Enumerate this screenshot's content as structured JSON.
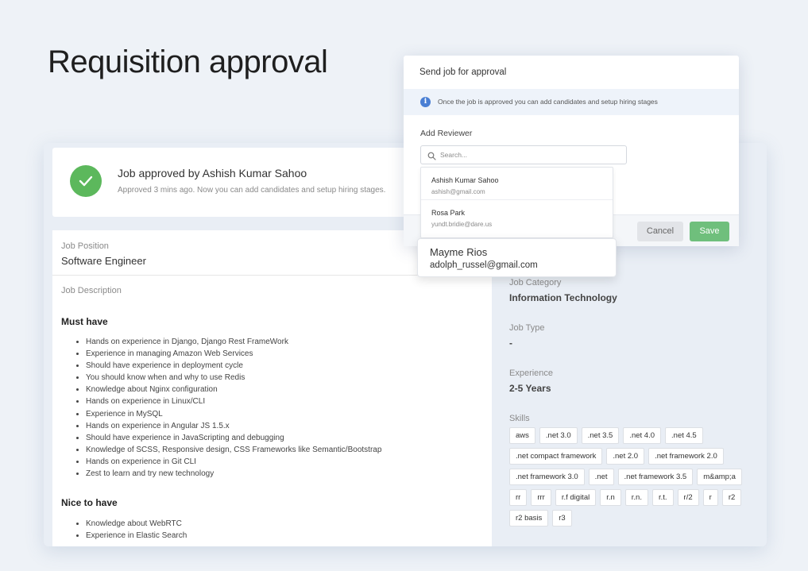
{
  "page": {
    "title": "Requisition approval"
  },
  "approval": {
    "title": "Job approved by Ashish Kumar Sahoo",
    "subtitle": "Approved 3 mins ago. Now you can add candidates and setup hiring stages."
  },
  "job": {
    "position_label": "Job Position",
    "position_value": "Software Engineer",
    "description_label": "Job Description",
    "must_have_heading": "Must have",
    "must_have": [
      "Hands on experience in Django, Django Rest FrameWork",
      "Experience in managing Amazon Web Services",
      "Should have experience in deployment cycle",
      "You should know when and why to use Redis",
      "Knowledge about Nginx configuration",
      "Hands on experience in Linux/CLI",
      "Experience in MySQL",
      "Hands on experience in Angular JS 1.5.x",
      "Should have experience in JavaScripting and debugging",
      "Knowledge of SCSS, Responsive design, CSS Frameworks like Semantic/Bootstrap",
      "Hands on experience in Git CLI",
      "Zest to learn and try new technology"
    ],
    "nice_to_have_heading": "Nice to have",
    "nice_to_have": [
      "Knowledge about WebRTC",
      "Experience in Elastic Search"
    ],
    "category_label": "Job Category",
    "category_value": "Information Technology",
    "type_label": "Job Type",
    "type_value": "-",
    "experience_label": "Experience",
    "experience_value": "2-5 Years",
    "skills_label": "Skills",
    "skills": [
      "aws",
      ".net 3.0",
      ".net 3.5",
      ".net 4.0",
      ".net 4.5",
      ".net compact framework",
      ".net 2.0",
      ".net framework 2.0",
      ".net framework 3.0",
      ".net",
      ".net framework 3.5",
      "m&amp;a",
      "rr",
      "rrr",
      "r.f digital",
      "r.n",
      "r.n.",
      "r.t.",
      "r/2",
      "r",
      "r2",
      "r2 basis",
      "r3"
    ]
  },
  "modal": {
    "title": "Send job for approval",
    "info": "Once the job is approved you can add candidates and setup hiring stages",
    "add_reviewer_label": "Add Reviewer",
    "search_placeholder": "Search...",
    "reviewers": [
      {
        "name": "Ashish Kumar Sahoo",
        "email": "ashish@gmail.com"
      },
      {
        "name": "Rosa Park",
        "email": "yundt.bridie@dare.us"
      }
    ],
    "cancel_label": "Cancel",
    "save_label": "Save"
  },
  "hovered_reviewer": {
    "name": "Mayme Rios",
    "email": "adolph_russel@gmail.com"
  },
  "colors": {
    "success": "#5cb85c",
    "save_button": "#6fbf7c",
    "info_icon": "#4a7fd4",
    "background": "#eef2f7"
  }
}
